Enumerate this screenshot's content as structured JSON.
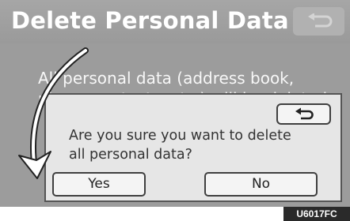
{
  "header": {
    "title": "Delete Personal Data"
  },
  "background": {
    "message_lines": [
      "All personal data (address book,",
      "phone contacts, etc.) will be deleted."
    ]
  },
  "dialog": {
    "message_lines": [
      "Are you sure you want to delete",
      "all personal data?"
    ],
    "yes_label": "Yes",
    "no_label": "No"
  },
  "figure_code": "U6017FC",
  "colors": {
    "title_bar": "#9f9f9f",
    "screen_background": "#9c9c9c",
    "dialog_background": "#e6e6e6",
    "button_background": "#f4f4f4"
  },
  "icons": {
    "title_back": "return-arrow-icon",
    "dialog_back": "return-arrow-icon",
    "overlay": "curved-arrow-icon"
  }
}
